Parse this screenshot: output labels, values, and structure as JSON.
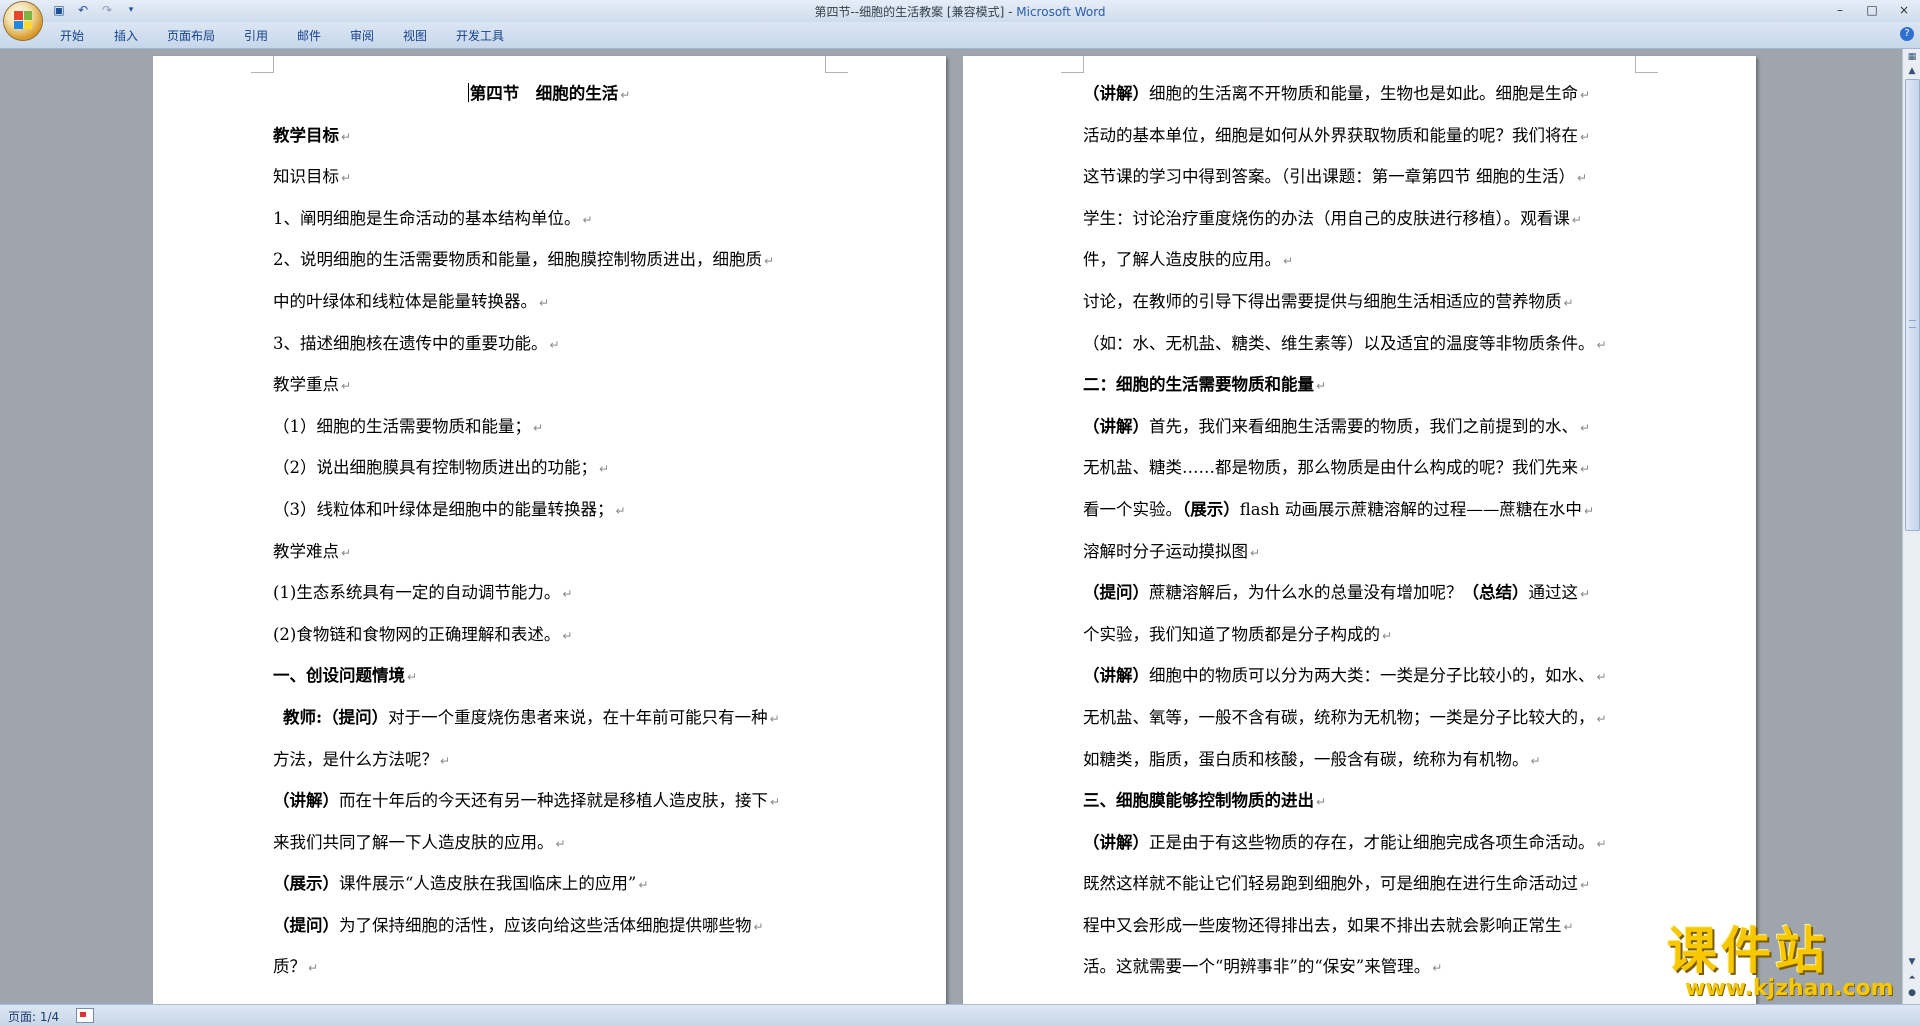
{
  "app": {
    "title_doc": "第四节--细胞的生活教案 [兼容模式] - ",
    "title_app": "Microsoft Word"
  },
  "ribbon": {
    "tabs": [
      "开始",
      "插入",
      "页面布局",
      "引用",
      "邮件",
      "审阅",
      "视图",
      "开发工具"
    ]
  },
  "window_controls": {
    "minimize": "–",
    "maximize": "□",
    "close": "×"
  },
  "status": {
    "page": "页面: 1/4"
  },
  "watermark": {
    "cn": "课件站",
    "url": "www.kjzhan.com"
  },
  "pages": [
    {
      "lines": [
        [
          {
            "t": "第四节　细胞的生活",
            "b": true
          }
        ],
        [
          {
            "t": "教学目标",
            "b": true
          }
        ],
        [
          {
            "t": "知识目标"
          }
        ],
        [
          {
            "t": "1、阐明细胞是生命活动的基本结构单位。"
          }
        ],
        [
          {
            "t": "2、说明细胞的生活需要物质和能量，细胞膜控制物质进出，细胞质"
          }
        ],
        [
          {
            "t": "中的叶绿体和线粒体是能量转换器。"
          }
        ],
        [
          {
            "t": "3、描述细胞核在遗传中的重要功能。"
          }
        ],
        [
          {
            "t": "教学重点"
          }
        ],
        [
          {
            "t": "（1）细胞的生活需要物质和能量；"
          }
        ],
        [
          {
            "t": "（2）说出细胞膜具有控制物质进出的功能；"
          }
        ],
        [
          {
            "t": "（3）线粒体和叶绿体是细胞中的能量转换器；"
          }
        ],
        [
          {
            "t": "教学难点"
          }
        ],
        [
          {
            "t": "(1)生态系统具有一定的自动调节能力。"
          }
        ],
        [
          {
            "t": "(2)食物链和食物网的正确理解和表述。"
          }
        ],
        [
          {
            "t": "一、创设问题情境",
            "b": true
          }
        ],
        [
          {
            "t": "教师:（提问）",
            "b": true
          },
          {
            "t": "对于一个重度烧伤患者来说，在十年前可能只有一种"
          }
        ],
        [
          {
            "t": "方法，是什么方法呢？"
          }
        ],
        [
          {
            "t": "（讲解）",
            "b": true
          },
          {
            "t": "而在十年后的今天还有另一种选择就是移植人造皮肤，接下"
          }
        ],
        [
          {
            "t": "来我们共同了解一下人造皮肤的应用。"
          }
        ],
        [
          {
            "t": "（展示）",
            "b": true
          },
          {
            "t": "课件展示“人造皮肤在我国临床上的应用”"
          }
        ],
        [
          {
            "t": "（提问）",
            "b": true
          },
          {
            "t": "为了保持细胞的活性，应该向给这些活体细胞提供哪些物"
          }
        ],
        [
          {
            "t": "质？"
          }
        ]
      ]
    },
    {
      "lines": [
        [
          {
            "t": "（讲解）",
            "b": true
          },
          {
            "t": "细胞的生活离不开物质和能量，生物也是如此。细胞是生命"
          }
        ],
        [
          {
            "t": "活动的基本单位，细胞是如何从外界获取物质和能量的呢？我们将在"
          }
        ],
        [
          {
            "t": "这节课的学习中得到答案。（引出课题：第一章第四节  细胞的生活）"
          }
        ],
        [
          {
            "t": "学生：讨论治疗重度烧伤的办法（用自己的皮肤进行移植）。观看课"
          }
        ],
        [
          {
            "t": "件，了解人造皮肤的应用。"
          }
        ],
        [
          {
            "t": "讨论，在教师的引导下得出需要提供与细胞生活相适应的营养物质"
          }
        ],
        [
          {
            "t": "（如：水、无机盐、糖类、维生素等）以及适宜的温度等非物质条件。"
          }
        ],
        [
          {
            "t": "二：细胞的生活需要物质和能量",
            "b": true
          }
        ],
        [
          {
            "t": "（讲解）",
            "b": true
          },
          {
            "t": "首先，我们来看细胞生活需要的物质，我们之前提到的水、"
          }
        ],
        [
          {
            "t": "无机盐、糖类……都是物质，那么物质是由什么构成的呢？我们先来"
          }
        ],
        [
          {
            "t": "看一个实验。"
          },
          {
            "t": "（展示）",
            "b": true
          },
          {
            "t": "flash 动画展示蔗糖溶解的过程——蔗糖在水中"
          }
        ],
        [
          {
            "t": "溶解时分子运动摸拟图"
          }
        ],
        [
          {
            "t": "（提问）",
            "b": true
          },
          {
            "t": "蔗糖溶解后，为什么水的总量没有增加呢？"
          },
          {
            "t": "（总结）",
            "b": true
          },
          {
            "t": "通过这"
          }
        ],
        [
          {
            "t": "个实验，我们知道了物质都是分子构成的"
          }
        ],
        [
          {
            "t": "（讲解）",
            "b": true
          },
          {
            "t": "细胞中的物质可以分为两大类：一类是分子比较小的，如水、"
          }
        ],
        [
          {
            "t": "无机盐、氧等，一般不含有碳，统称为无机物；一类是分子比较大的，"
          }
        ],
        [
          {
            "t": "如糖类，脂质，蛋白质和核酸，一般含有碳，统称为有机物。"
          }
        ],
        [
          {
            "t": "三、细胞膜能够控制物质的进出",
            "b": true
          }
        ],
        [
          {
            "t": "（讲解）",
            "b": true
          },
          {
            "t": "正是由于有这些物质的存在，才能让细胞完成各项生命活动。"
          }
        ],
        [
          {
            "t": "既然这样就不能让它们轻易跑到细胞外，可是细胞在进行生命活动过"
          }
        ],
        [
          {
            "t": "程中又会形成一些废物还得排出去，如果不排出去就会影响正常生"
          }
        ],
        [
          {
            "t": "活。这就需要一个“明辨事非”的“保安”来管理。"
          }
        ]
      ]
    }
  ]
}
